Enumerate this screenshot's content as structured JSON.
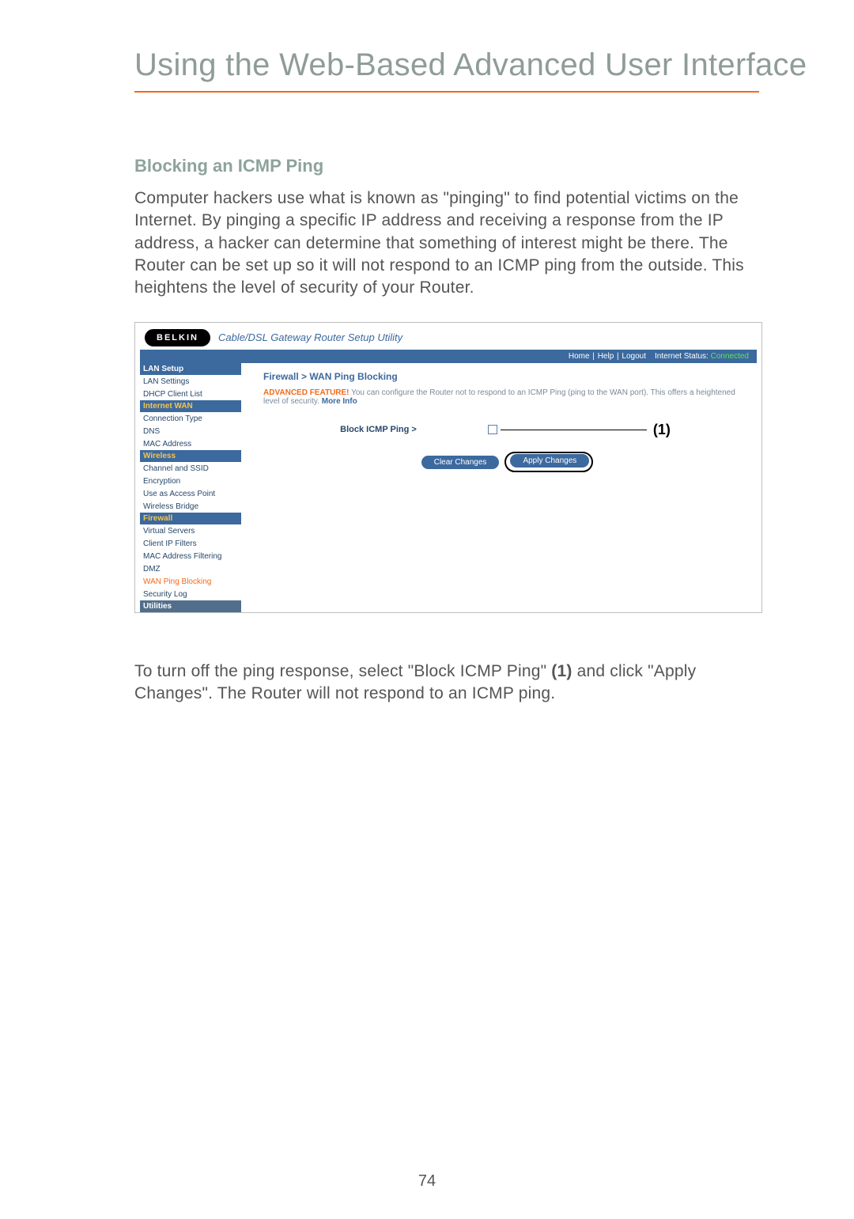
{
  "page": {
    "title": "Using the Web-Based Advanced User Interface",
    "number": "74"
  },
  "section": {
    "heading": "Blocking an ICMP Ping",
    "body1": "Computer hackers use what is known as \"pinging\" to find potential victims on the Internet. By pinging a specific IP address and receiving a response from the IP address, a hacker can determine that something of interest might be there. The Router can be set up so it will not respond to an ICMP ping from the outside. This heightens the level of security of your Router.",
    "body2_pre": "To turn off the ping response, select \"Block ICMP Ping\" ",
    "body2_bold": "(1)",
    "body2_post": " and click \"Apply Changes\". The Router will not respond to an ICMP ping."
  },
  "shot": {
    "brand": "BELKIN",
    "utility": "Cable/DSL Gateway Router Setup Utility",
    "topbar": {
      "home": "Home",
      "help": "Help",
      "logout": "Logout",
      "istatus_label": "Internet Status:",
      "istatus_value": "Connected"
    },
    "sidebar": {
      "lan_setup": "LAN Setup",
      "lan_items": [
        "LAN Settings",
        "DHCP Client List"
      ],
      "internet_wan": "Internet WAN",
      "wan_items": [
        "Connection Type",
        "DNS",
        "MAC Address"
      ],
      "wireless": "Wireless",
      "wireless_items": [
        "Channel and SSID",
        "Encryption",
        "Use as Access Point",
        "Wireless Bridge"
      ],
      "firewall": "Firewall",
      "firewall_items": [
        "Virtual Servers",
        "Client IP Filters",
        "MAC Address Filtering",
        "DMZ",
        "WAN Ping Blocking",
        "Security Log"
      ],
      "utilities": "Utilities"
    },
    "main": {
      "breadcrumb": "Firewall > WAN Ping Blocking",
      "adv_label": "ADVANCED FEATURE!",
      "adv_text": " You can configure the Router not to respond to an ICMP Ping (ping to the WAN port). This offers a heightened level of security. ",
      "more_info": "More Info",
      "block_label": "Block ICMP Ping >",
      "callout": "(1)",
      "clear": "Clear Changes",
      "apply": "Apply Changes"
    }
  }
}
